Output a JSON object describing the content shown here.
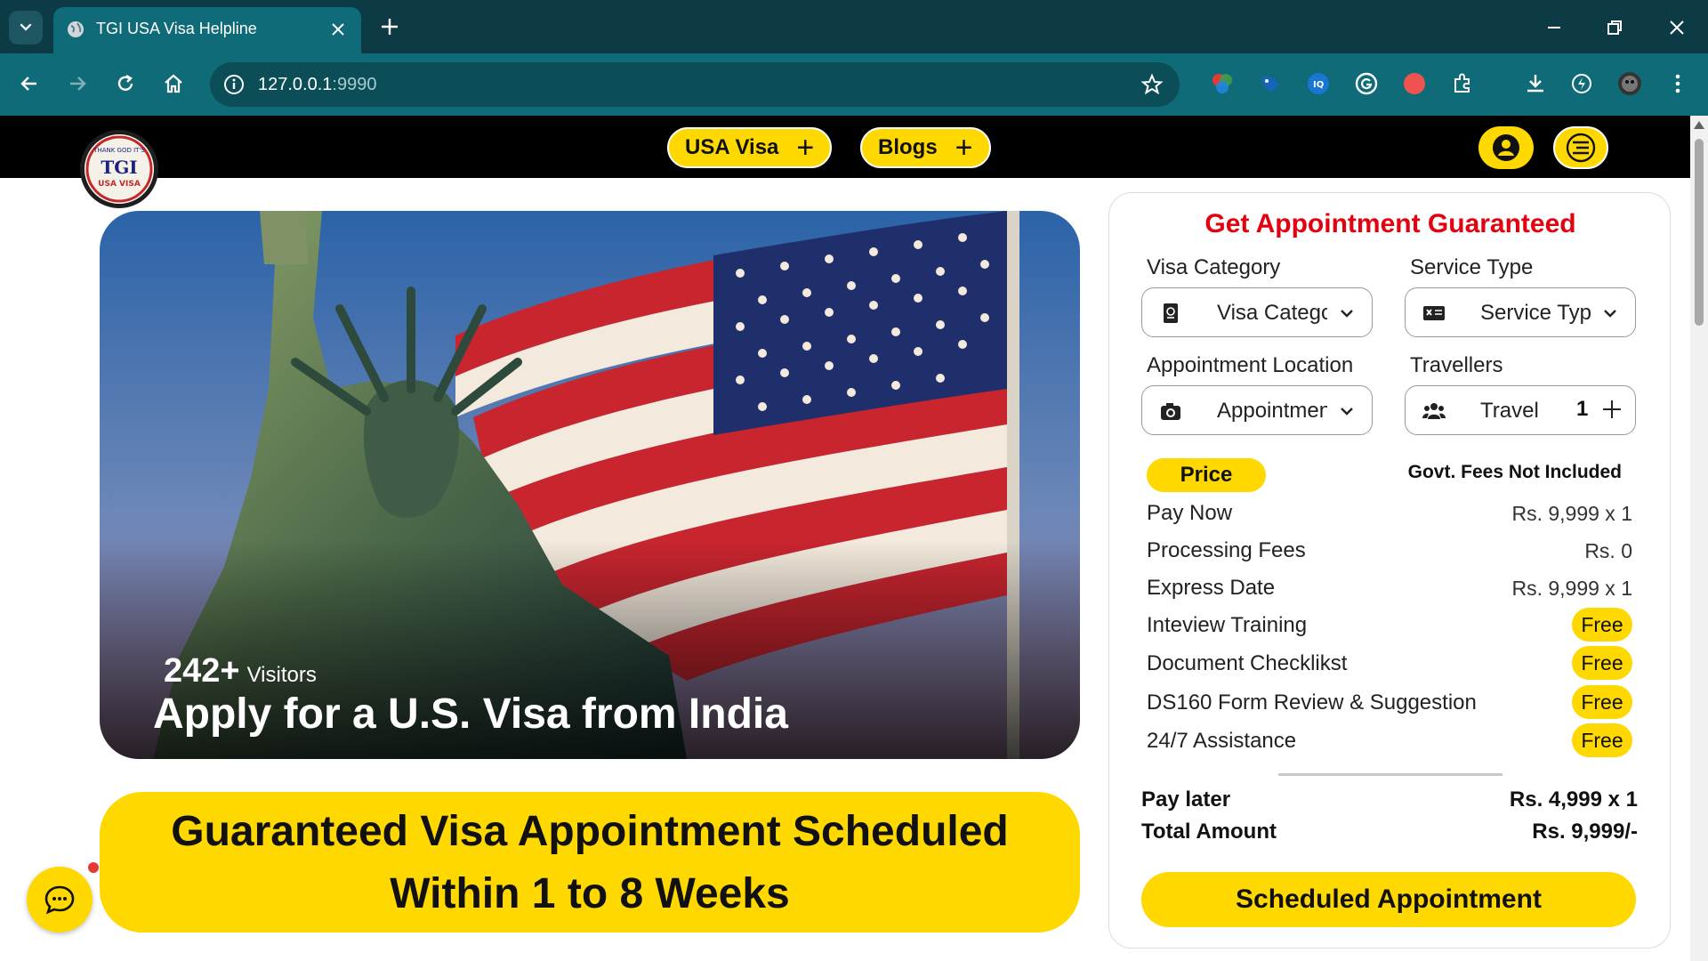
{
  "browser": {
    "tab_title": "TGI USA Visa Helpline",
    "url_host": "127.0.0.1",
    "url_port": ":9990"
  },
  "header": {
    "logo_top": "THANK GOD IT'S",
    "logo_main": "TGI",
    "logo_sub": "USA VISA",
    "nav": [
      {
        "label": "USA Visa",
        "plus": "+"
      },
      {
        "label": "Blogs",
        "plus": "+"
      }
    ]
  },
  "hero": {
    "visitors_count": "242+",
    "visitors_label": "Visitors",
    "headline": "Apply for a U.S. Visa from India"
  },
  "guarantee": {
    "line1": "Guaranteed Visa Appointment Scheduled",
    "line2": "Within 1 to 8 Weeks"
  },
  "form": {
    "title": "Get Appointment Guaranteed",
    "visa_category_label": "Visa Category",
    "visa_category_value": "Visa Category",
    "service_type_label": "Service Type",
    "service_type_value": "Service Type",
    "location_label": "Appointment Location",
    "location_value": "Appointment Location",
    "travellers_label": "Travellers",
    "travellers_value": "Travel",
    "travellers_count": "1",
    "price_label": "Price",
    "govt_note": "Govt. Fees Not Included",
    "rows": [
      {
        "label": "Pay Now",
        "value": "Rs. 9,999 x 1"
      },
      {
        "label": "Processing Fees",
        "value": "Rs. 0"
      },
      {
        "label": "Express Date",
        "value": "Rs. 9,999 x 1"
      },
      {
        "label": "Inteview Training",
        "value": "Free"
      },
      {
        "label": "Document Checklikst",
        "value": "Free"
      },
      {
        "label": "DS160 Form Review & Suggestion",
        "value": "Free"
      },
      {
        "label": "24/7 Assistance",
        "value": "Free"
      }
    ],
    "pay_later_label": "Pay later",
    "pay_later_value": "Rs. 4,999 x 1",
    "total_label": "Total Amount",
    "total_value": "Rs. 9,999/-",
    "cta": "Scheduled Appointment"
  },
  "colors": {
    "accent": "#ffd800",
    "title_red": "#e3000f",
    "chrome_dark": "#0d3b45",
    "chrome_toolbar": "#0f6b78"
  }
}
